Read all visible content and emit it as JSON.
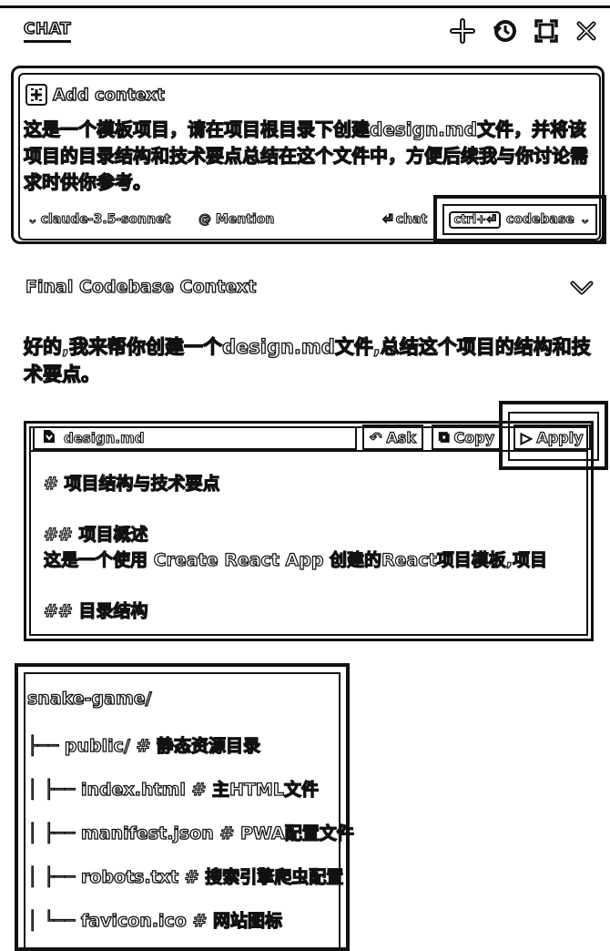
{
  "header": {
    "title": "CHAT",
    "icons": [
      "plus-icon",
      "history-icon",
      "expand-icon",
      "close-icon"
    ]
  },
  "composer": {
    "add_context_label": "Add context",
    "prompt_text": "这是一个模板项目，请在项目根目录下创建design.md文件，并将该项目的目录结构和技术要点总结在这个文件中，方便后续我与你讨论需求时供你参考。",
    "model_label": "claude-3.5-sonnet",
    "mention_label": "@ Mention",
    "chat_label": "chat",
    "shortcut_label": "ctrl+⏎",
    "codebase_label": "codebase"
  },
  "codebase_context": {
    "label": "Final Codebase Context"
  },
  "assistant": {
    "reply_text": "好的,我来帮你创建一个design.md文件,总结这个项目的结构和技术要点。"
  },
  "code_block": {
    "file_name": "design.md",
    "ask_label": "Ask",
    "copy_label": "Copy",
    "apply_label": "Apply",
    "lines": [
      "# 项目结构与技术要点",
      "",
      "## 项目概述",
      "这是一个使用 Create React App 创建的React项目模板,项目",
      "",
      "## 目录结构"
    ]
  },
  "tree": {
    "lines": [
      "snake-game/",
      "├── public/ # 静态资源目录",
      "│ ├── index.html # 主HTML文件",
      "│ ├── manifest.json # PWA配置文件",
      "│ ├── robots.txt # 搜索引擎爬虫配置",
      "│ └── favicon.ico # 网站图标"
    ]
  }
}
